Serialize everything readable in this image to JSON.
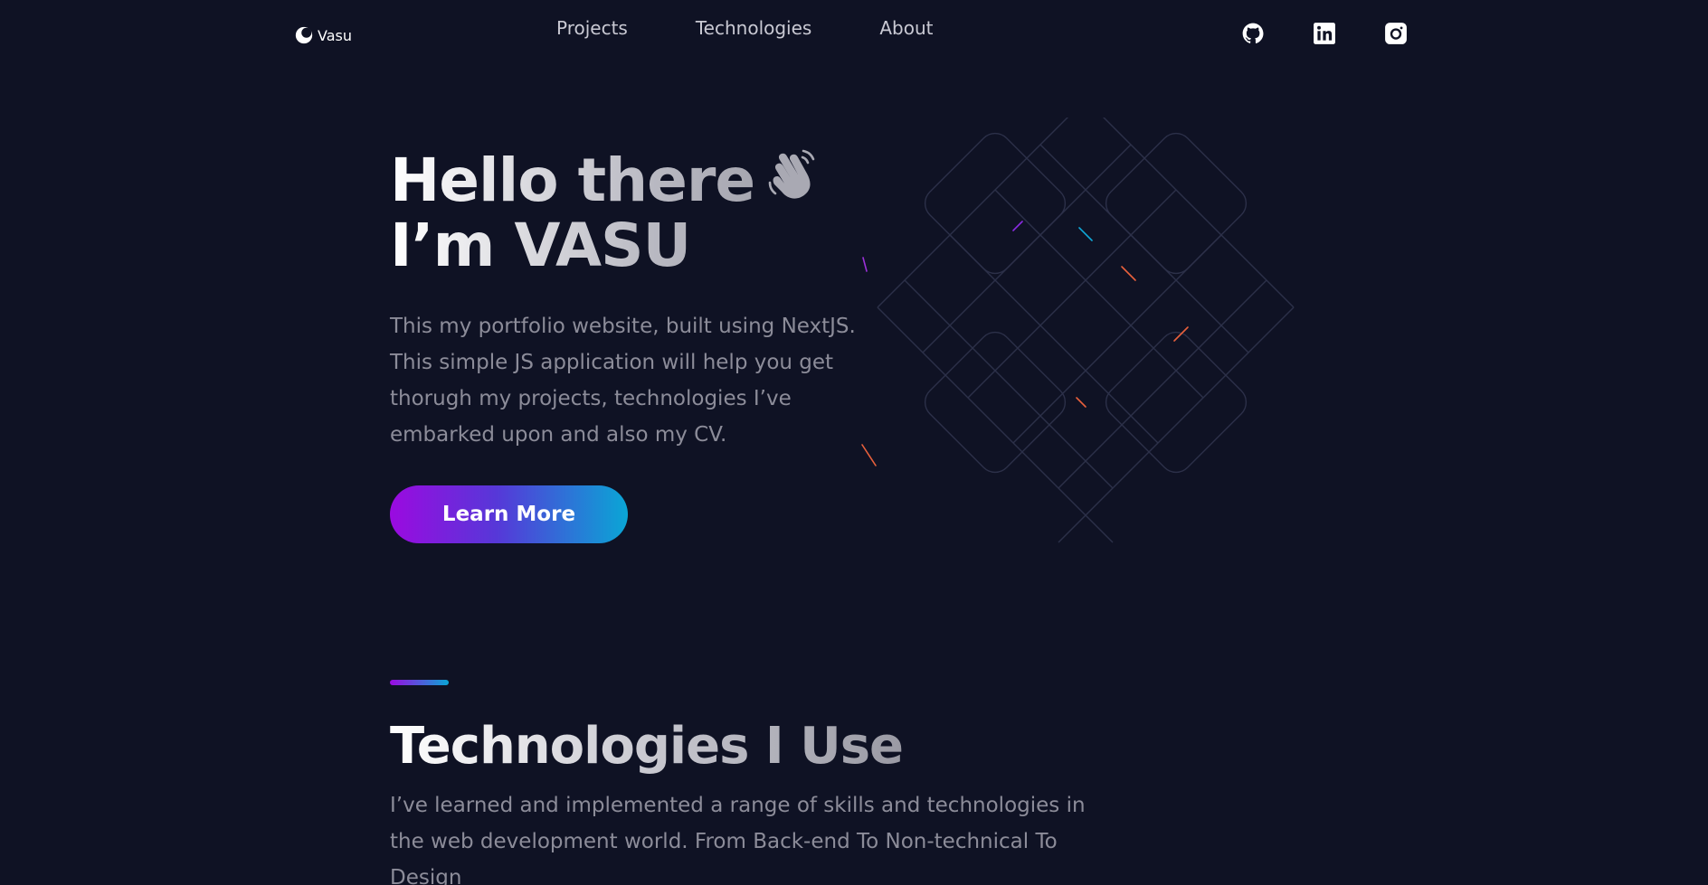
{
  "header": {
    "logo_text": "Vasu",
    "nav": [
      {
        "label": "Projects"
      },
      {
        "label": "Technologies"
      },
      {
        "label": "About"
      }
    ],
    "socials": [
      {
        "icon": "github-icon"
      },
      {
        "icon": "linkedin-icon"
      },
      {
        "icon": "instagram-icon"
      }
    ]
  },
  "hero": {
    "title_line1": "Hello there",
    "title_line2": "I’m VASU",
    "description": "This my portfolio website, built using NextJS. This simple JS application will help you get thorugh my projects, technologies I’ve embarked upon and also my CV.",
    "cta_label": "Learn More"
  },
  "technologies": {
    "title": "Technologies I Use",
    "description": "I’ve learned and implemented a range of skills and technologies in the web development world. From Back-end To Non-technical To Design"
  },
  "colors": {
    "background": "#0f1224",
    "accent_purple": "#9b0ae0",
    "accent_cyan": "#0aa6d6",
    "muted_text": "#8c8c99"
  }
}
